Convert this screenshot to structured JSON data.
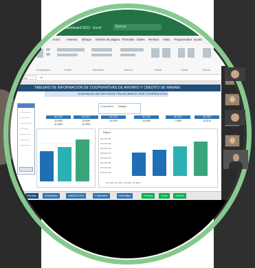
{
  "window": {
    "title": "Tablero CAC dashboard 2023 - Excel",
    "search_placeholder": "Buscar"
  },
  "ribbon": {
    "tabs": [
      "Archivo",
      "Inicio",
      "Insertar",
      "Dibujar",
      "Diseño de página",
      "Fórmulas",
      "Datos",
      "Revisar",
      "Vista",
      "Programador",
      "Ayuda",
      "Power Pivot"
    ],
    "groups": [
      "Portapapeles",
      "Fuente",
      "Alineación",
      "Número",
      "Estilos",
      "Celdas",
      "Edición"
    ]
  },
  "formula_bar": {
    "name_box": "C1",
    "fx": "fx"
  },
  "sheet": {
    "header": "TABLERO DE INFORMACION DE COOPERATIVAS DE AHORRO Y CREDITO DE MANABI",
    "subheader": "VARIABLES DE ESTADOS FINANCIEROS POR COOPERATIVA",
    "selector": {
      "label": "Cooperativa",
      "value": "(Todas)"
    },
    "kpis_left": [
      {
        "head": "dic 2020",
        "v1": "12.00%",
        "v2": "11.34%"
      },
      {
        "head": "dic 2021",
        "v1": "13.00%",
        "v2": "12.29%"
      }
    ],
    "kpis_right": [
      {
        "head": "dic 2020",
        "v1": "14.02%"
      },
      {
        "head": "dic 2021",
        "v1": "13.64%"
      },
      {
        "head": "dic 2022",
        "v1": "7.99%"
      },
      {
        "head": "dic 2023",
        "v1": "13.31%"
      }
    ],
    "panel_right_title": "Pasivo",
    "y_ticks": [
      "500.000.000",
      "450.000.000",
      "400.000.000",
      "350.000.000",
      "300.000.000",
      "250.000.000",
      "200.000.000",
      "150.000.000"
    ],
    "legend": [
      "dic 2020",
      "dic 2021",
      "dic 2022",
      "dic 2023"
    ]
  },
  "chart_data": [
    {
      "type": "bar",
      "title": "",
      "categories": [
        "dic 2021",
        "dic 2022",
        "dic 2023"
      ],
      "values": [
        0.55,
        0.62,
        0.76
      ]
    },
    {
      "type": "bar",
      "title": "Pasivo",
      "categories": [
        "dic 2020",
        "dic 2021",
        "dic 2022",
        "dic 2023"
      ],
      "values": [
        0.56,
        0.64,
        0.72,
        0.84
      ]
    }
  ],
  "sheet_tabs": [
    {
      "label": "Portada",
      "color": "#1f4e79"
    },
    {
      "label": "Indicadores",
      "color": "#2e75b6"
    },
    {
      "label": "Indi2020-2023",
      "color": "#2e75b6"
    },
    {
      "label": "Publicacion",
      "color": "#2e75b6"
    },
    {
      "label": "IndiCalifica",
      "color": "#2e75b6"
    },
    {
      "label": "Ranking",
      "color": "#00b050"
    },
    {
      "label": "Pobla",
      "color": "#00b050"
    },
    {
      "label": "IndiCalif",
      "color": "#00b050"
    }
  ],
  "colors": {
    "excel_green": "#217346",
    "ring": "#86c98f",
    "bar_dark": "#1f6fb5",
    "bar_teal": "#2bb1b1",
    "bar_green": "#3aa57a"
  }
}
